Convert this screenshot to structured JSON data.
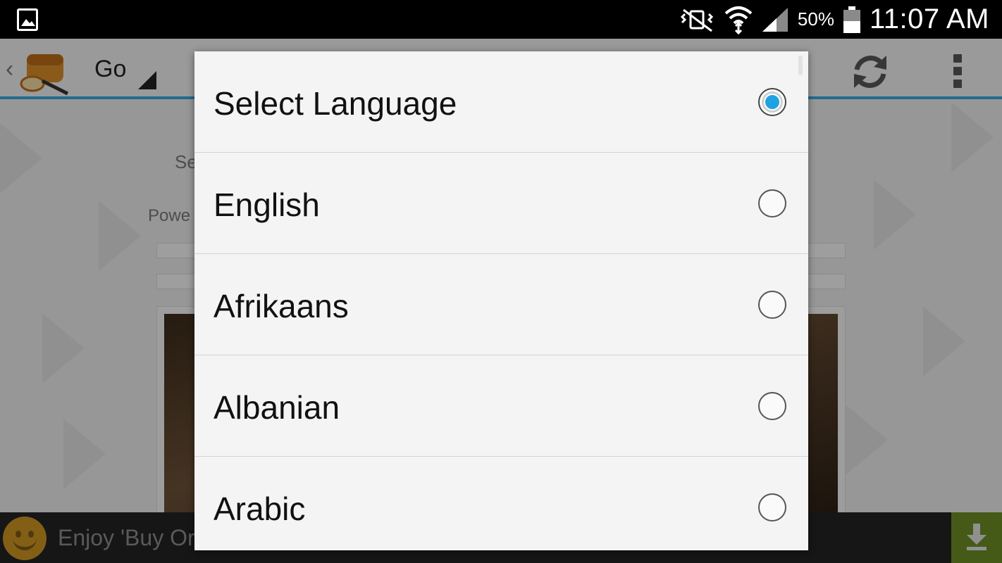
{
  "status_bar": {
    "battery_percent": "50%",
    "time": "11:07 AM",
    "icons": [
      "gallery-icon",
      "vibrate-mute-icon",
      "wifi-icon",
      "signal-icon",
      "battery-icon"
    ]
  },
  "action_bar": {
    "title": "Go",
    "icons": [
      "back-chevron-icon",
      "app-bread-icon",
      "dropdown-triangle-icon",
      "refresh-icon",
      "overflow-menu-icon"
    ]
  },
  "background": {
    "label_1": "Se",
    "label_2": "Powe"
  },
  "ad_banner": {
    "text": "Enjoy 'Buy Or",
    "icons": [
      "smiley-icon",
      "download-icon"
    ]
  },
  "dialog": {
    "options": [
      {
        "label": "Select Language",
        "checked": true
      },
      {
        "label": "English",
        "checked": false
      },
      {
        "label": "Afrikaans",
        "checked": false
      },
      {
        "label": "Albanian",
        "checked": false
      },
      {
        "label": "Arabic",
        "checked": false
      }
    ]
  },
  "colors": {
    "accent": "#33a6dc",
    "radio_selected": "#1fa3e0",
    "ad_download_bg": "#6b8a22"
  }
}
